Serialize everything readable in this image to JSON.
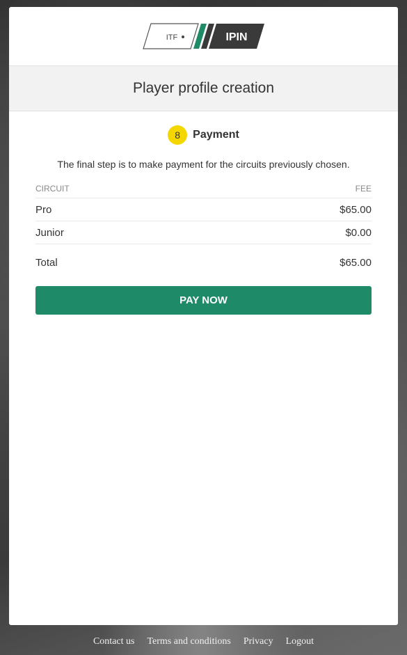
{
  "logo": {
    "left_text": "ITF",
    "right_text": "IPIN"
  },
  "header": {
    "title": "Player profile creation"
  },
  "step": {
    "number": "8",
    "label": "Payment"
  },
  "intro": "The final step is to make payment for the circuits previously chosen.",
  "table": {
    "columns": [
      "CIRCUIT",
      "FEE"
    ],
    "rows": [
      {
        "circuit": "Pro",
        "fee": "$65.00"
      },
      {
        "circuit": "Junior",
        "fee": "$0.00"
      }
    ],
    "total_label": "Total",
    "total_value": "$65.00"
  },
  "actions": {
    "pay_label": "PAY NOW"
  },
  "footer": {
    "links": [
      "Contact us",
      "Terms and conditions",
      "Privacy",
      "Logout"
    ]
  },
  "colors": {
    "accent_green": "#1f8a68",
    "step_badge": "#f5d700",
    "logo_dark": "#3a3a3a"
  }
}
